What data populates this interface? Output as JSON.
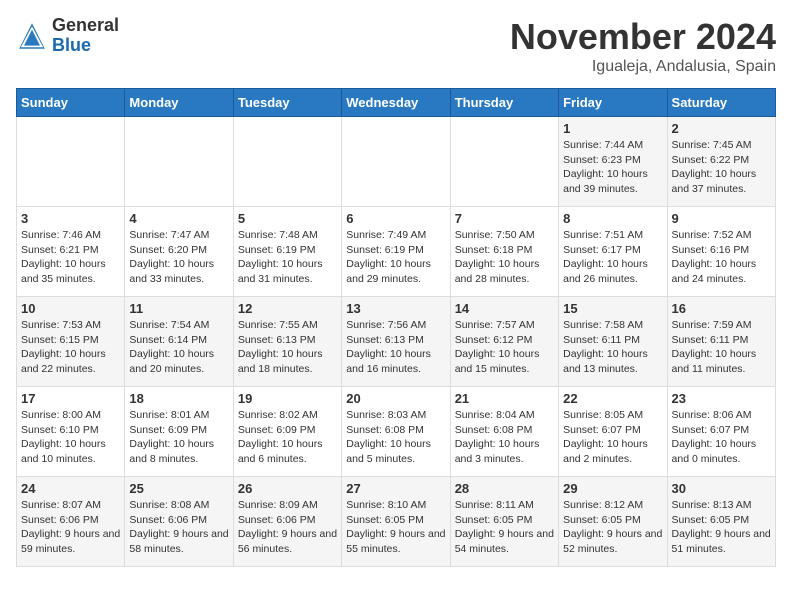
{
  "header": {
    "logo_general": "General",
    "logo_blue": "Blue",
    "month_year": "November 2024",
    "location": "Igualeja, Andalusia, Spain"
  },
  "calendar": {
    "days_of_week": [
      "Sunday",
      "Monday",
      "Tuesday",
      "Wednesday",
      "Thursday",
      "Friday",
      "Saturday"
    ],
    "weeks": [
      [
        {
          "day": "",
          "info": ""
        },
        {
          "day": "",
          "info": ""
        },
        {
          "day": "",
          "info": ""
        },
        {
          "day": "",
          "info": ""
        },
        {
          "day": "",
          "info": ""
        },
        {
          "day": "1",
          "info": "Sunrise: 7:44 AM\nSunset: 6:23 PM\nDaylight: 10 hours and 39 minutes."
        },
        {
          "day": "2",
          "info": "Sunrise: 7:45 AM\nSunset: 6:22 PM\nDaylight: 10 hours and 37 minutes."
        }
      ],
      [
        {
          "day": "3",
          "info": "Sunrise: 7:46 AM\nSunset: 6:21 PM\nDaylight: 10 hours and 35 minutes."
        },
        {
          "day": "4",
          "info": "Sunrise: 7:47 AM\nSunset: 6:20 PM\nDaylight: 10 hours and 33 minutes."
        },
        {
          "day": "5",
          "info": "Sunrise: 7:48 AM\nSunset: 6:19 PM\nDaylight: 10 hours and 31 minutes."
        },
        {
          "day": "6",
          "info": "Sunrise: 7:49 AM\nSunset: 6:19 PM\nDaylight: 10 hours and 29 minutes."
        },
        {
          "day": "7",
          "info": "Sunrise: 7:50 AM\nSunset: 6:18 PM\nDaylight: 10 hours and 28 minutes."
        },
        {
          "day": "8",
          "info": "Sunrise: 7:51 AM\nSunset: 6:17 PM\nDaylight: 10 hours and 26 minutes."
        },
        {
          "day": "9",
          "info": "Sunrise: 7:52 AM\nSunset: 6:16 PM\nDaylight: 10 hours and 24 minutes."
        }
      ],
      [
        {
          "day": "10",
          "info": "Sunrise: 7:53 AM\nSunset: 6:15 PM\nDaylight: 10 hours and 22 minutes."
        },
        {
          "day": "11",
          "info": "Sunrise: 7:54 AM\nSunset: 6:14 PM\nDaylight: 10 hours and 20 minutes."
        },
        {
          "day": "12",
          "info": "Sunrise: 7:55 AM\nSunset: 6:13 PM\nDaylight: 10 hours and 18 minutes."
        },
        {
          "day": "13",
          "info": "Sunrise: 7:56 AM\nSunset: 6:13 PM\nDaylight: 10 hours and 16 minutes."
        },
        {
          "day": "14",
          "info": "Sunrise: 7:57 AM\nSunset: 6:12 PM\nDaylight: 10 hours and 15 minutes."
        },
        {
          "day": "15",
          "info": "Sunrise: 7:58 AM\nSunset: 6:11 PM\nDaylight: 10 hours and 13 minutes."
        },
        {
          "day": "16",
          "info": "Sunrise: 7:59 AM\nSunset: 6:11 PM\nDaylight: 10 hours and 11 minutes."
        }
      ],
      [
        {
          "day": "17",
          "info": "Sunrise: 8:00 AM\nSunset: 6:10 PM\nDaylight: 10 hours and 10 minutes."
        },
        {
          "day": "18",
          "info": "Sunrise: 8:01 AM\nSunset: 6:09 PM\nDaylight: 10 hours and 8 minutes."
        },
        {
          "day": "19",
          "info": "Sunrise: 8:02 AM\nSunset: 6:09 PM\nDaylight: 10 hours and 6 minutes."
        },
        {
          "day": "20",
          "info": "Sunrise: 8:03 AM\nSunset: 6:08 PM\nDaylight: 10 hours and 5 minutes."
        },
        {
          "day": "21",
          "info": "Sunrise: 8:04 AM\nSunset: 6:08 PM\nDaylight: 10 hours and 3 minutes."
        },
        {
          "day": "22",
          "info": "Sunrise: 8:05 AM\nSunset: 6:07 PM\nDaylight: 10 hours and 2 minutes."
        },
        {
          "day": "23",
          "info": "Sunrise: 8:06 AM\nSunset: 6:07 PM\nDaylight: 10 hours and 0 minutes."
        }
      ],
      [
        {
          "day": "24",
          "info": "Sunrise: 8:07 AM\nSunset: 6:06 PM\nDaylight: 9 hours and 59 minutes."
        },
        {
          "day": "25",
          "info": "Sunrise: 8:08 AM\nSunset: 6:06 PM\nDaylight: 9 hours and 58 minutes."
        },
        {
          "day": "26",
          "info": "Sunrise: 8:09 AM\nSunset: 6:06 PM\nDaylight: 9 hours and 56 minutes."
        },
        {
          "day": "27",
          "info": "Sunrise: 8:10 AM\nSunset: 6:05 PM\nDaylight: 9 hours and 55 minutes."
        },
        {
          "day": "28",
          "info": "Sunrise: 8:11 AM\nSunset: 6:05 PM\nDaylight: 9 hours and 54 minutes."
        },
        {
          "day": "29",
          "info": "Sunrise: 8:12 AM\nSunset: 6:05 PM\nDaylight: 9 hours and 52 minutes."
        },
        {
          "day": "30",
          "info": "Sunrise: 8:13 AM\nSunset: 6:05 PM\nDaylight: 9 hours and 51 minutes."
        }
      ]
    ]
  }
}
